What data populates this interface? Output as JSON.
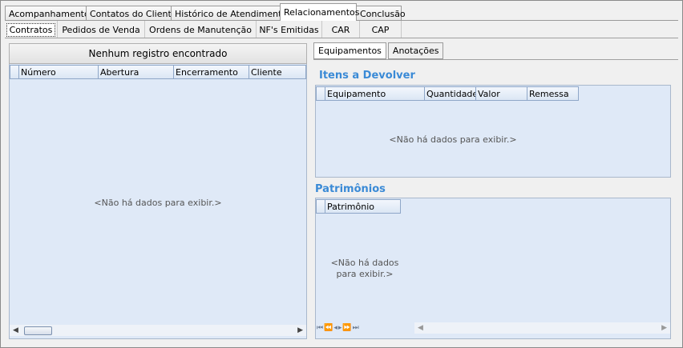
{
  "main_tabs": [
    "Acompanhamentos",
    "Contatos do Cliente",
    "Histórico de Atendimentos",
    "Relacionamentos",
    "Conclusão"
  ],
  "sub_tabs": [
    "Contratos",
    "Pedidos de Venda",
    "Ordens de Manutenção",
    "NF's Emitidas",
    "CAR",
    "CAP"
  ],
  "contratos": {
    "group_header": "Nenhum registro encontrado",
    "columns": [
      "Número",
      "Abertura",
      "Encerramento",
      "Cliente"
    ],
    "empty_text": "<Não há dados para exibir.>"
  },
  "right_tabs": [
    "Equipamentos",
    "Anotações"
  ],
  "itens": {
    "title": "Itens a Devolver",
    "columns": [
      "Equipamento",
      "Quantidade",
      "Valor",
      "Remessa"
    ],
    "empty_text": "<Não há dados para exibir.>"
  },
  "patrimonios": {
    "title": "Patrimônios",
    "columns": [
      "Patrimônio"
    ],
    "empty_line1": "<Não há dados",
    "empty_line2": "para exibir.>"
  }
}
